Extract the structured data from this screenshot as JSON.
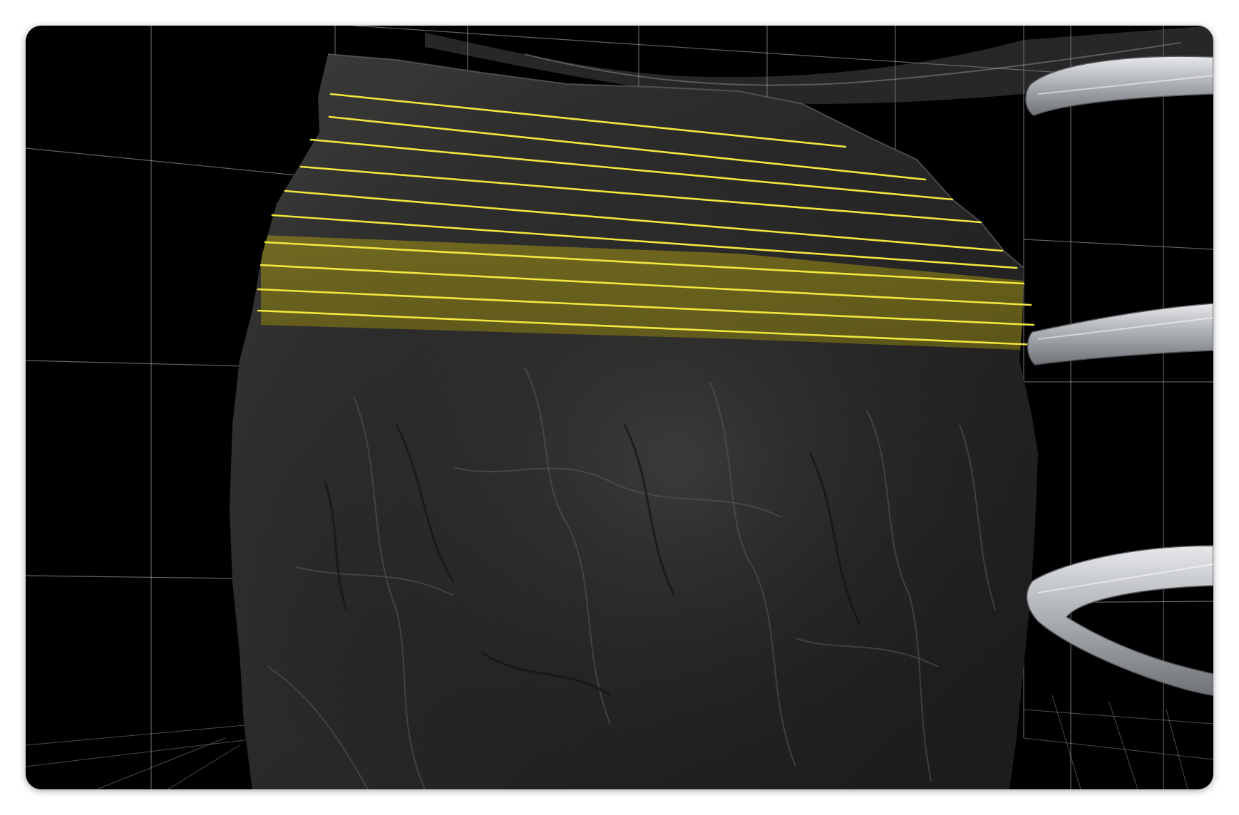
{
  "scene": {
    "description_icon": "rock-cross-section-visualization",
    "colors": {
      "background": "#000000",
      "rock_base": "#2a2a2a",
      "rock_highlight": "#4a4a48",
      "grid_line": "#cfcfcf",
      "layer_line": "#f2e640",
      "layer_band": "#c9b81f",
      "pipe_metal": "#b9bcc0"
    },
    "layer_lines_count": 10,
    "highlighted_band": true
  }
}
